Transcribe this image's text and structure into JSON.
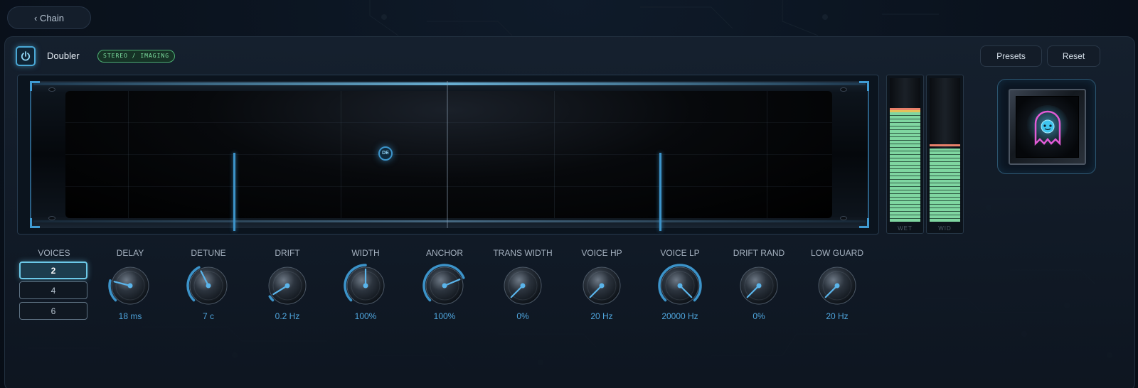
{
  "nav": {
    "back_label": "‹ Chain"
  },
  "header": {
    "plugin_name": "Doubler",
    "category_badge": "STEREO / IMAGING",
    "presets_label": "Presets",
    "reset_label": "Reset"
  },
  "display": {
    "drift_dot_label": "DE"
  },
  "meters": [
    {
      "label": "WET",
      "level": 0.76
    },
    {
      "label": "WID",
      "level": 0.51
    }
  ],
  "voices": {
    "label": "VOICES",
    "options": [
      "2",
      "4",
      "6"
    ],
    "selected": "2"
  },
  "knobs": [
    {
      "label": "DELAY",
      "value": "18 ms",
      "fill": 0.22
    },
    {
      "label": "DETUNE",
      "value": "7 c",
      "fill": 0.4
    },
    {
      "label": "DRIFT",
      "value": "0.2 Hz",
      "fill": 0.05
    },
    {
      "label": "WIDTH",
      "value": "100%",
      "fill": 0.5
    },
    {
      "label": "ANCHOR",
      "value": "100%",
      "fill": 0.75
    },
    {
      "label": "TRANS WIDTH",
      "value": "0%",
      "fill": 0.0
    },
    {
      "label": "VOICE HP",
      "value": "20 Hz",
      "fill": 0.0
    },
    {
      "label": "VOICE LP",
      "value": "20000 Hz",
      "fill": 1.0
    },
    {
      "label": "DRIFT RAND",
      "value": "0%",
      "fill": 0.0
    },
    {
      "label": "LOW GUARD",
      "value": "20 Hz",
      "fill": 0.0
    }
  ],
  "colors": {
    "accent": "#3c93c9",
    "meter_green": "#7fd6a1",
    "badge_green": "#7fe0a2"
  }
}
